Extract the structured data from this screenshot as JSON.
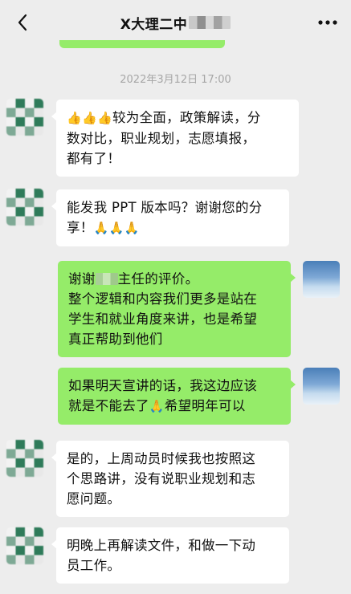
{
  "header": {
    "title": "X大理二中",
    "back_icon": "chevron-left-icon",
    "more_icon": "more-dots-icon"
  },
  "timestamp": "2022年3月12日 17:00",
  "messages": [
    {
      "side": "in",
      "emoji": "👍👍👍",
      "lines": [
        "较为全面，政策解读，分",
        "数对比，职业规划，志愿填报，",
        "都有了！"
      ]
    },
    {
      "side": "in",
      "lines": [
        "能发我 PPT 版本吗？谢谢您的分",
        "享！"
      ],
      "emoji": "🙏🙏🙏"
    },
    {
      "side": "out",
      "prefix": "谢谢",
      "line1_rest": "主任的评价。",
      "lines": [
        "整个逻辑和内容我们更多是站在",
        "学生和就业角度来讲，也是希望",
        "真正帮助到他们"
      ]
    },
    {
      "side": "out",
      "line1": "如果明天宣讲的话，我这边应该",
      "line2_a": "就是不能去了",
      "emoji": "🙏",
      "line2_b": "希望明年可以"
    },
    {
      "side": "in",
      "lines": [
        "是的，上周动员时候我也按照这",
        "个思路讲，没有说职业规划和志",
        "愿问题。"
      ]
    },
    {
      "side": "in",
      "lines": [
        "明晚上再解读文件，和做一下动",
        "员工作。"
      ]
    }
  ]
}
